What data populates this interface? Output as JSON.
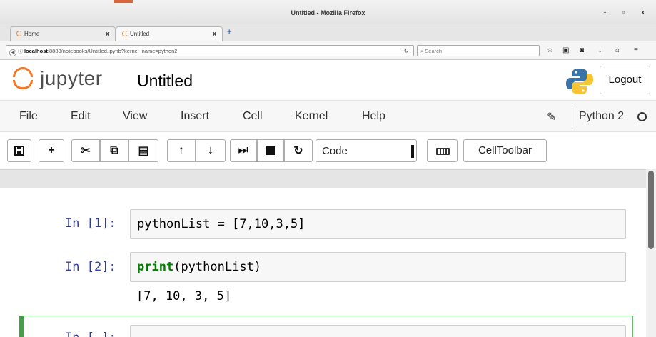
{
  "browser": {
    "window_title": "Untitled - Mozilla Firefox",
    "window_controls": {
      "minimize": "-",
      "maximize": "▫",
      "close": "x"
    },
    "tabs": [
      {
        "label": "Home",
        "close": "x"
      },
      {
        "label": "Untitled",
        "close": "x"
      }
    ],
    "new_tab": "+",
    "url": {
      "host": "localhost",
      "rest": ":8888/notebooks/Untitled.ipynb?kernel_name=python2"
    },
    "search_placeholder": "Search",
    "nav_icons": [
      "star-icon",
      "bookmarks-icon",
      "pocket-icon",
      "download-icon",
      "home-icon",
      "menu-icon"
    ]
  },
  "jupyter": {
    "logo_text": "jupyter",
    "notebook_name": "Untitled",
    "logout_label": "Logout",
    "menu": [
      "File",
      "Edit",
      "View",
      "Insert",
      "Cell",
      "Kernel",
      "Help"
    ],
    "kernel_name": "Python 2",
    "toolbar": {
      "cell_type": "Code",
      "celltoolbar_label": "CellToolbar"
    }
  },
  "cells": [
    {
      "prompt": "In [1]:",
      "source": "pythonList = [7,10,3,5]"
    },
    {
      "prompt": "In [2]:",
      "source_func": "print",
      "source_arg": "pythonList",
      "output": "[7, 10, 3, 5]"
    },
    {
      "prompt": "In [ ]:"
    }
  ],
  "colors": {
    "jupyter_orange": "#f37726",
    "prompt_blue": "#303f9f",
    "selected_cell_green": "#43a047"
  }
}
